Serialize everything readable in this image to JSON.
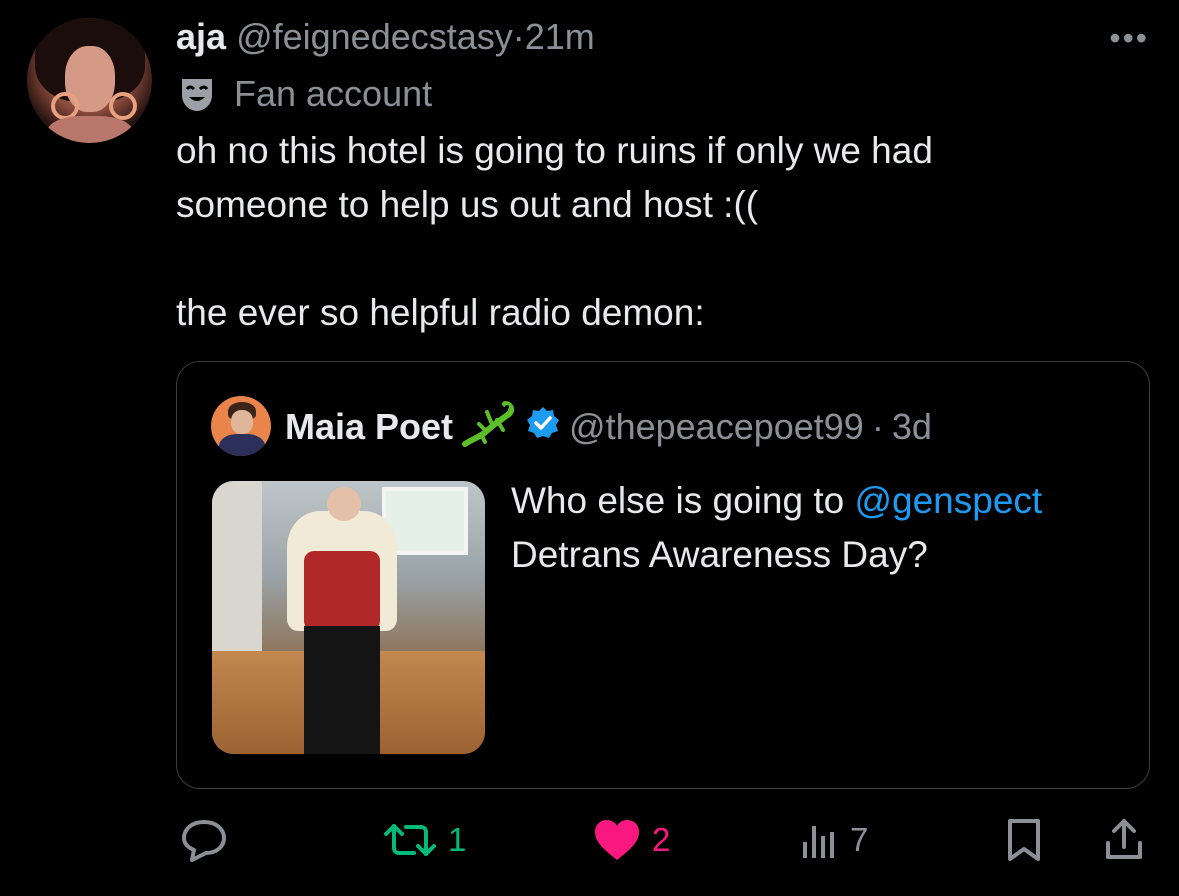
{
  "tweet": {
    "author_name": "aja",
    "author_handle": "@feignedecstasy",
    "dot": "·",
    "time": "21m",
    "more": "•••",
    "badge_label": "Fan account",
    "badge_icon": "theater-mask-icon",
    "text_lines": [
      "oh no this hotel is going to ruins if only we had",
      "someone to help us out and host :((",
      "the ever so helpful radio demon:"
    ]
  },
  "quote": {
    "author_name": "Maia Poet",
    "emoji_icon": "lizard-icon",
    "verified_icon": "verified-badge-icon",
    "author_handle": "@thepeacepoet99",
    "dot": "·",
    "time": "3d",
    "text_prefix": "Who else is going to ",
    "mention": "@genspect",
    "text_suffix": "Detrans Awareness Day?"
  },
  "actions": {
    "reply_count": "",
    "retweet_count": "1",
    "like_count": "2",
    "views_count": "7"
  },
  "colors": {
    "background": "#000000",
    "text": "#e7e9ea",
    "secondary": "#8b9097",
    "link": "#1d9bf0",
    "retweet": "#00ba7c",
    "like": "#f91880"
  }
}
